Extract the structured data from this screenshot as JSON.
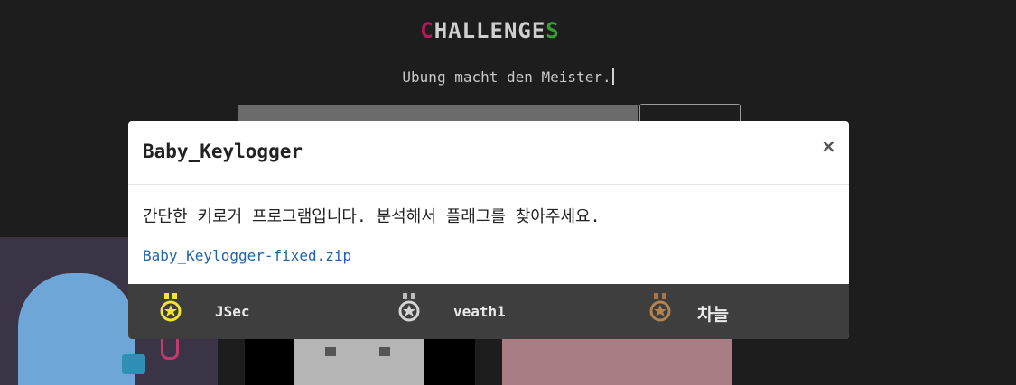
{
  "header": {
    "title_first": "C",
    "title_middle": "HALLENGE",
    "title_last": "S",
    "subtitle": "Ubung macht den Meister."
  },
  "modal": {
    "title": "Baby_Keylogger",
    "close_label": "×",
    "description": "간단한 키로거 프로그램입니다. 분석해서 플래그를 찾아주세요.",
    "attachment": "Baby_Keylogger-fixed.zip",
    "solvers": [
      {
        "name": "JSec",
        "medal": "gold-medal-icon",
        "color": "#f1e33a"
      },
      {
        "name": "veath1",
        "medal": "silver-medal-icon",
        "color": "#c9c9c9"
      },
      {
        "name": "차늘",
        "medal": "bronze-medal-icon",
        "color": "#b2844f"
      }
    ]
  },
  "colors": {
    "background": "#1d1d1d",
    "title_accent_red": "#b31a5a",
    "title_accent_green": "#3b9c3b",
    "link": "#1f63a8",
    "solver_bar": "#3e3e3e"
  }
}
